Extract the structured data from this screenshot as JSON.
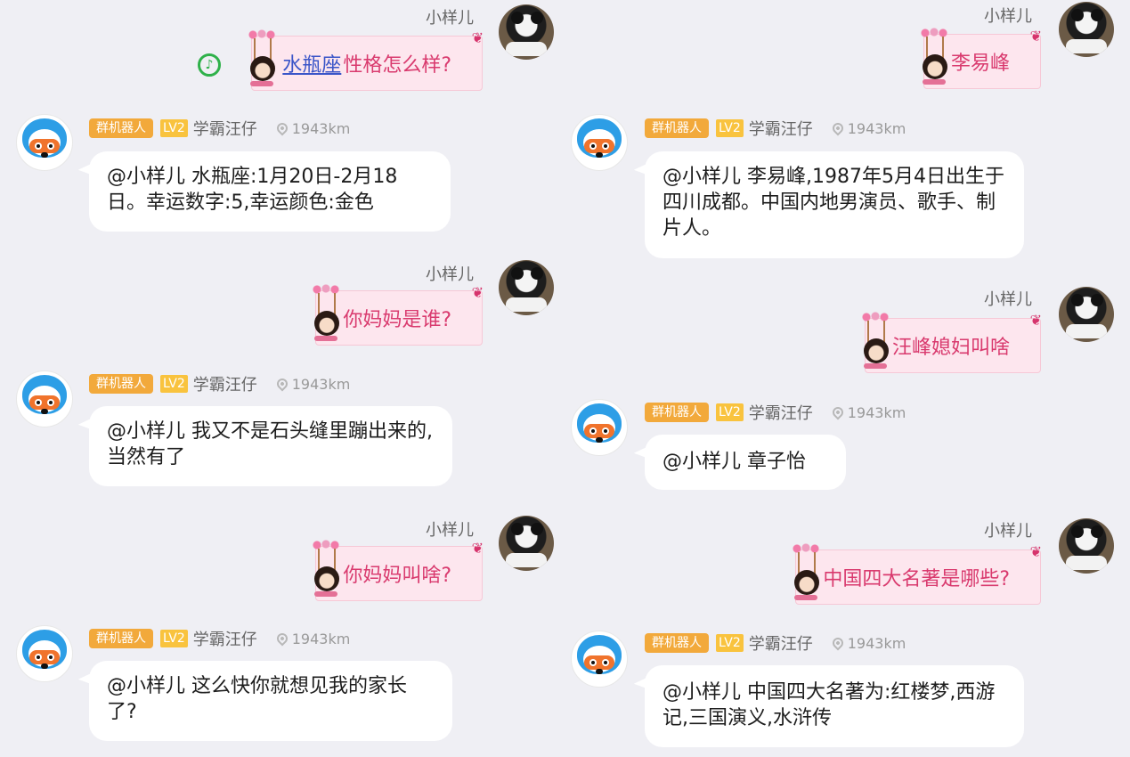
{
  "self_name": "小样儿",
  "bot": {
    "robot_tag": "群机器人",
    "level": "LV2",
    "nick": "学霸汪仔",
    "distance": "1943km"
  },
  "icons": {
    "self_avatar": "panda-avatar",
    "bot_avatar": "dog-mascot-avatar",
    "location": "location-pin-icon",
    "music": "music-note-icon"
  },
  "colors": {
    "background": "#efeff4",
    "self_bubble": "#fde6ee",
    "self_text": "#d93a6e",
    "link": "#3a55c8",
    "robot_tag": "#f2a93b",
    "level_tag": "#f9c33e"
  },
  "left": [
    {
      "q_link": "水瓶座",
      "q_text": "性格怎么样?",
      "a_text": "@小样儿 水瓶座:1月20日-2月18日。幸运数字:5,幸运颜色:金色"
    },
    {
      "q_text": "你妈妈是谁?",
      "a_text": "@小样儿 我又不是石头缝里蹦出来的,当然有了"
    },
    {
      "q_text": "你妈妈叫啥?",
      "a_text": "@小样儿 这么快你就想见我的家长了?"
    }
  ],
  "right": [
    {
      "q_text": "李易峰",
      "a_text": "@小样儿 李易峰,1987年5月4日出生于四川成都。中国内地男演员、歌手、制片人。"
    },
    {
      "q_text": "汪峰媳妇叫啥",
      "a_text": "@小样儿 章子怡"
    },
    {
      "q_text": "中国四大名著是哪些?",
      "a_text": "@小样儿 中国四大名著为:红楼梦,西游记,三国演义,水浒传"
    }
  ]
}
